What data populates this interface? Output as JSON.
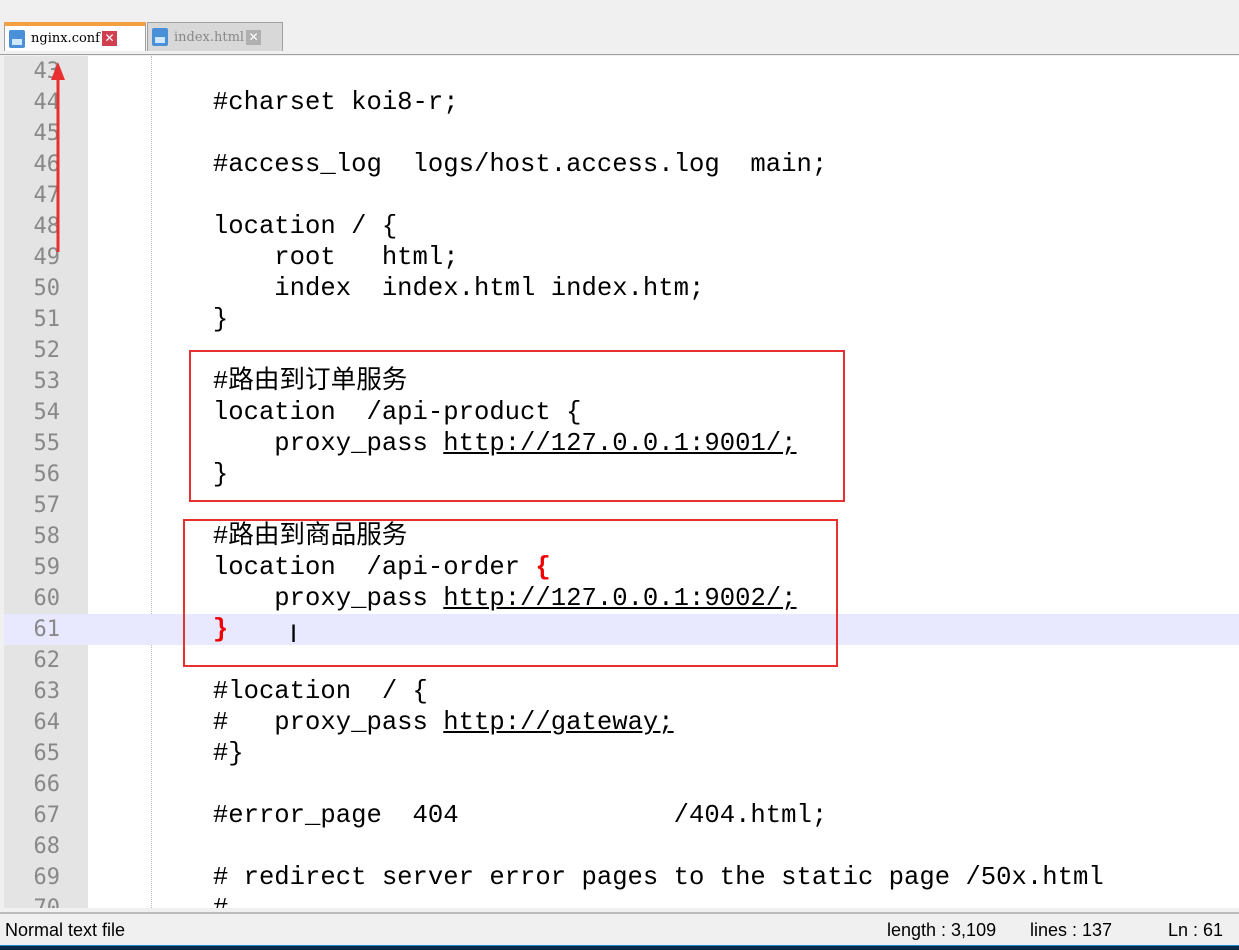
{
  "tabs": [
    {
      "label": "nginx.conf",
      "active": true
    },
    {
      "label": "index.html",
      "active": false
    }
  ],
  "lines": [
    {
      "n": "43",
      "segs": []
    },
    {
      "n": "44",
      "segs": [
        {
          "t": "        #charset koi8-r;"
        }
      ]
    },
    {
      "n": "45",
      "segs": []
    },
    {
      "n": "46",
      "segs": [
        {
          "t": "        #access_log  logs/host.access.log  main;"
        }
      ]
    },
    {
      "n": "47",
      "segs": []
    },
    {
      "n": "48",
      "segs": [
        {
          "t": "        location / {"
        }
      ]
    },
    {
      "n": "49",
      "segs": [
        {
          "t": "            root   html;"
        }
      ]
    },
    {
      "n": "50",
      "segs": [
        {
          "t": "            index  index.html index.htm;"
        }
      ]
    },
    {
      "n": "51",
      "segs": [
        {
          "t": "        }"
        }
      ]
    },
    {
      "n": "52",
      "segs": []
    },
    {
      "n": "53",
      "segs": [
        {
          "t": "        #路由到订单服务"
        }
      ]
    },
    {
      "n": "54",
      "segs": [
        {
          "t": "        location  /api-product {"
        }
      ]
    },
    {
      "n": "55",
      "segs": [
        {
          "t": "            proxy_pass "
        },
        {
          "t": "http://127.0.0.1:9001/;",
          "u": true
        }
      ]
    },
    {
      "n": "56",
      "segs": [
        {
          "t": "        }"
        }
      ]
    },
    {
      "n": "57",
      "segs": []
    },
    {
      "n": "58",
      "segs": [
        {
          "t": "        #路由到商品服务"
        }
      ]
    },
    {
      "n": "59",
      "segs": [
        {
          "t": "        location  /api-order "
        },
        {
          "t": "{",
          "r": true
        }
      ]
    },
    {
      "n": "60",
      "segs": [
        {
          "t": "            proxy_pass "
        },
        {
          "t": "http://127.0.0.1:9002/;",
          "u": true
        }
      ]
    },
    {
      "n": "61",
      "segs": [
        {
          "t": "        "
        },
        {
          "t": "}",
          "r": true
        }
      ],
      "current": true
    },
    {
      "n": "62",
      "segs": []
    },
    {
      "n": "63",
      "segs": [
        {
          "t": "        #location  / {"
        }
      ]
    },
    {
      "n": "64",
      "segs": [
        {
          "t": "        #   proxy_pass "
        },
        {
          "t": "http://gateway;",
          "u": true
        }
      ]
    },
    {
      "n": "65",
      "segs": [
        {
          "t": "        #}"
        }
      ]
    },
    {
      "n": "66",
      "segs": []
    },
    {
      "n": "67",
      "segs": [
        {
          "t": "        #error_page  404              /404.html;"
        }
      ]
    },
    {
      "n": "68",
      "segs": []
    },
    {
      "n": "69",
      "segs": [
        {
          "t": "        # redirect server error pages to the static page /50x.html"
        }
      ]
    },
    {
      "n": "70",
      "segs": [
        {
          "t": "        #"
        }
      ]
    }
  ],
  "status": {
    "file_type": "Normal text file",
    "length": "length : 3,109",
    "lines": "lines : 137",
    "ln": "Ln : 61"
  },
  "colors": {
    "annotation": "#e83030",
    "current_line": "#e8e8ff",
    "active_tab_accent": "#f5a040"
  }
}
